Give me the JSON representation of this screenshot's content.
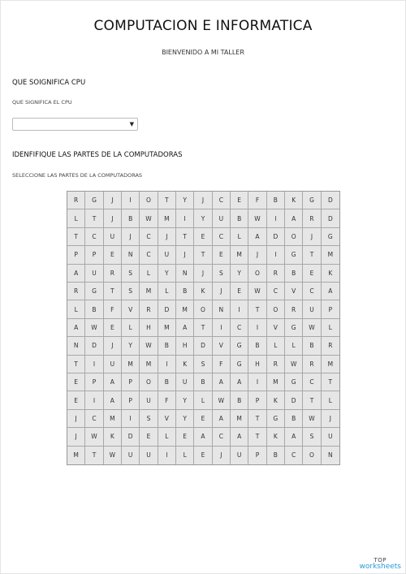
{
  "header": {
    "title": "COMPUTACION E INFORMATICA",
    "subtitle": "BIENVENIDO A MI TALLER"
  },
  "question1": {
    "title": "QUE SOIGNIFICA CPU",
    "prompt": "QUE SIGNIFICA EL CPU",
    "selected_value": ""
  },
  "question2": {
    "title": "IDENFIFIQUE LAS PARTES DE LA COMPUTADORAS",
    "prompt": "SELECCIONE LAS PARTES DE LA COMPUTADORAS"
  },
  "wordsearch": {
    "rows": [
      [
        "R",
        "G",
        "J",
        "I",
        "O",
        "T",
        "Y",
        "J",
        "C",
        "E",
        "F",
        "B",
        "K",
        "G",
        "D"
      ],
      [
        "L",
        "T",
        "J",
        "B",
        "W",
        "M",
        "I",
        "Y",
        "U",
        "B",
        "W",
        "I",
        "A",
        "R",
        "D"
      ],
      [
        "T",
        "C",
        "U",
        "J",
        "C",
        "J",
        "T",
        "E",
        "C",
        "L",
        "A",
        "D",
        "O",
        "J",
        "G"
      ],
      [
        "P",
        "P",
        "E",
        "N",
        "C",
        "U",
        "J",
        "T",
        "E",
        "M",
        "J",
        "I",
        "G",
        "T",
        "M"
      ],
      [
        "A",
        "U",
        "R",
        "S",
        "L",
        "Y",
        "N",
        "J",
        "S",
        "Y",
        "O",
        "R",
        "B",
        "E",
        "K"
      ],
      [
        "R",
        "G",
        "T",
        "S",
        "M",
        "L",
        "B",
        "K",
        "J",
        "E",
        "W",
        "C",
        "V",
        "C",
        "A"
      ],
      [
        "L",
        "B",
        "F",
        "V",
        "R",
        "D",
        "M",
        "O",
        "N",
        "I",
        "T",
        "O",
        "R",
        "U",
        "P"
      ],
      [
        "A",
        "W",
        "E",
        "L",
        "H",
        "M",
        "A",
        "T",
        "I",
        "C",
        "I",
        "V",
        "G",
        "W",
        "L"
      ],
      [
        "N",
        "D",
        "J",
        "Y",
        "W",
        "B",
        "H",
        "D",
        "V",
        "G",
        "B",
        "L",
        "L",
        "B",
        "R"
      ],
      [
        "T",
        "I",
        "U",
        "M",
        "M",
        "I",
        "K",
        "S",
        "F",
        "G",
        "H",
        "R",
        "W",
        "R",
        "M"
      ],
      [
        "E",
        "P",
        "A",
        "P",
        "O",
        "B",
        "U",
        "B",
        "A",
        "A",
        "I",
        "M",
        "G",
        "C",
        "T"
      ],
      [
        "E",
        "I",
        "A",
        "P",
        "U",
        "F",
        "Y",
        "L",
        "W",
        "B",
        "P",
        "K",
        "D",
        "T",
        "L"
      ],
      [
        "J",
        "C",
        "M",
        "I",
        "S",
        "V",
        "Y",
        "E",
        "A",
        "M",
        "T",
        "G",
        "B",
        "W",
        "J"
      ],
      [
        "J",
        "W",
        "K",
        "D",
        "E",
        "L",
        "E",
        "A",
        "C",
        "A",
        "T",
        "K",
        "A",
        "S",
        "U"
      ],
      [
        "M",
        "T",
        "W",
        "U",
        "U",
        "I",
        "L",
        "E",
        "J",
        "U",
        "P",
        "B",
        "C",
        "O",
        "N"
      ]
    ]
  },
  "branding": {
    "top": "TOP",
    "worksheets": "worksheets"
  }
}
